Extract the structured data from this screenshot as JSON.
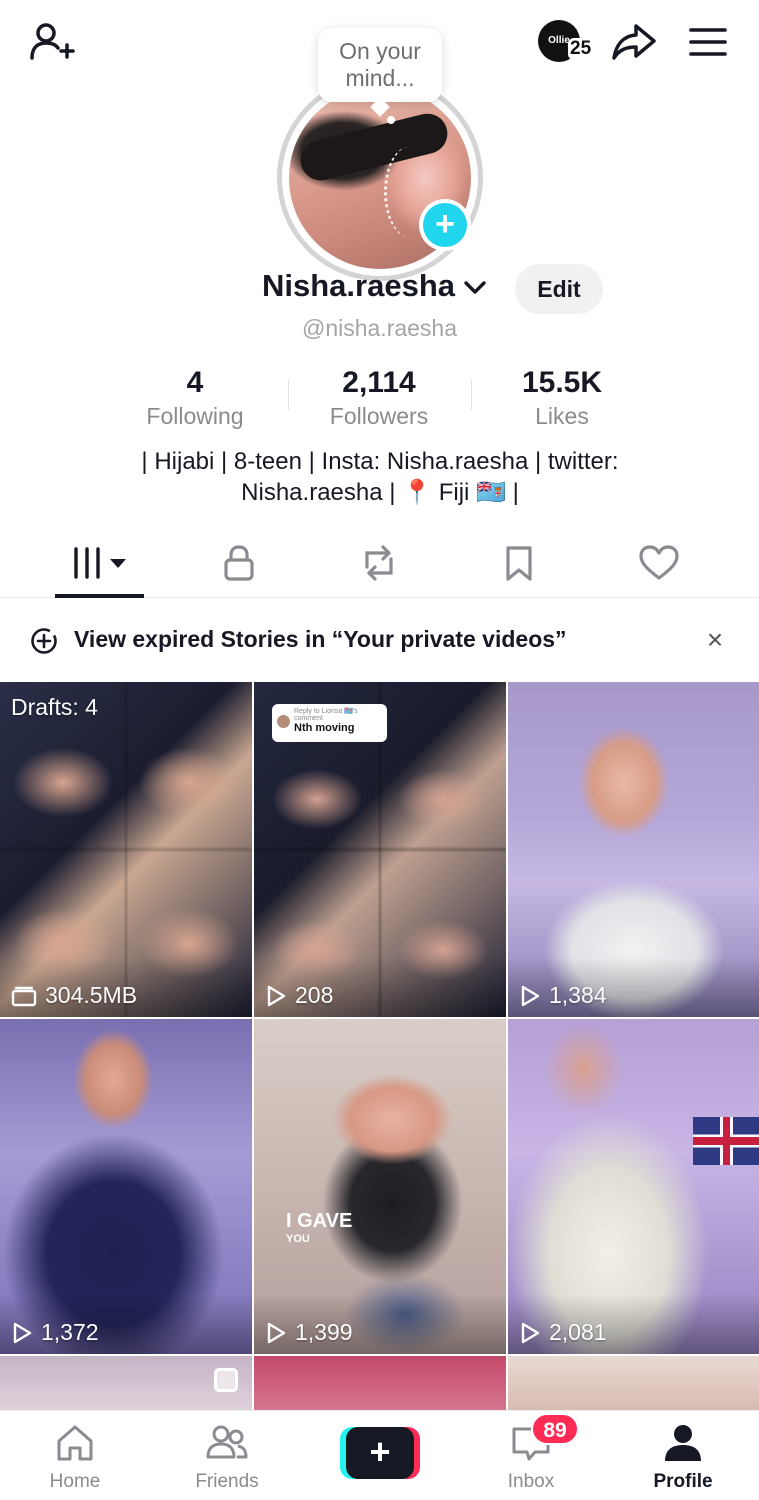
{
  "header": {
    "profile_views_label": "Ollie",
    "profile_views_count": "25",
    "add_friend_icon": "person-plus-icon",
    "share_icon": "share-arrow-icon",
    "menu_icon": "hamburger-menu-icon"
  },
  "avatar": {
    "note_line1": "On your",
    "note_line2": "mind...",
    "add_story_icon": "plus-icon"
  },
  "profile": {
    "display_name": "Nisha.raesha",
    "handle": "@nisha.raesha",
    "edit_label": "Edit"
  },
  "stats": [
    {
      "value": "4",
      "label": "Following"
    },
    {
      "value": "2,114",
      "label": "Followers"
    },
    {
      "value": "15.5K",
      "label": "Likes"
    }
  ],
  "bio": {
    "line1": "| Hijabi | 8-teen | Insta: Nisha.raesha | twitter:",
    "line2": "Nisha.raesha | 📍 Fiji 🇫🇯 |"
  },
  "tabs": [
    {
      "icon": "videos-grid-icon",
      "active": true
    },
    {
      "icon": "lock-icon",
      "active": false
    },
    {
      "icon": "repost-icon",
      "active": false
    },
    {
      "icon": "bookmark-icon",
      "active": false
    },
    {
      "icon": "heart-icon",
      "active": false
    }
  ],
  "notice": {
    "text": "View expired Stories in “Your private videos”",
    "close": "×"
  },
  "grid": {
    "drafts_label": "Drafts: 4",
    "items": [
      {
        "stat": "304.5MB",
        "kind": "drafts"
      },
      {
        "stat": "208",
        "kind": "views",
        "reply_sticker_line1": "Reply to Lionsa 🇫🇯's comment",
        "reply_sticker_line2": "Nth moving"
      },
      {
        "stat": "1,384",
        "kind": "views"
      },
      {
        "stat": "1,372",
        "kind": "views"
      },
      {
        "stat": "1,399",
        "kind": "views",
        "caption_big": "I GAVE",
        "caption_small": "YOU"
      },
      {
        "stat": "2,081",
        "kind": "views"
      }
    ]
  },
  "bottom_nav": {
    "home": "Home",
    "friends": "Friends",
    "create": "+",
    "inbox": "Inbox",
    "inbox_badge": "89",
    "profile": "Profile"
  },
  "colors": {
    "accent_cyan": "#20d5ec",
    "tiktok_red": "#fe2c55",
    "tiktok_cyan": "#25f4ee",
    "text_primary": "#161823",
    "text_secondary": "#8a8b91"
  }
}
